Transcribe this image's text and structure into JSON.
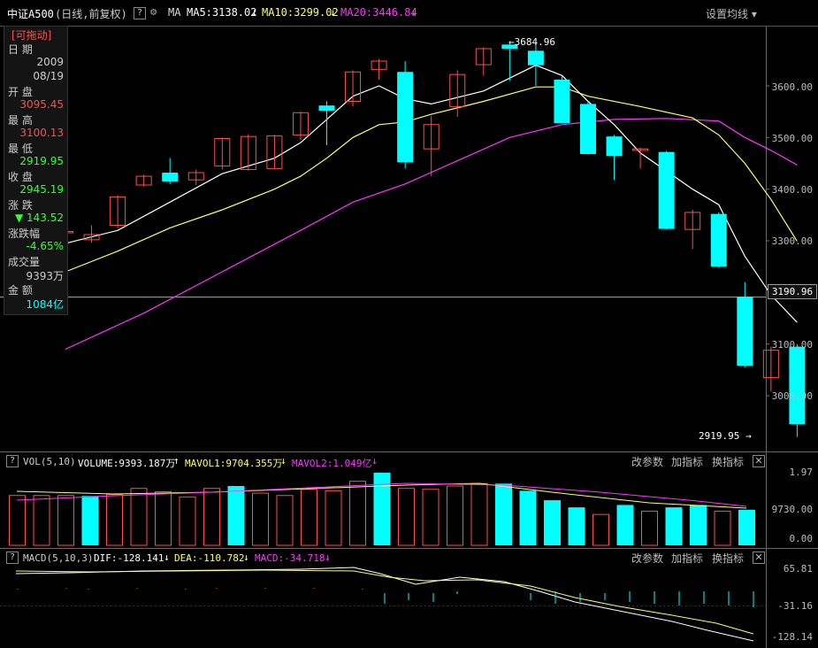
{
  "header": {
    "symbol": "中证A500",
    "period": "(日线,前复权)",
    "help": "?",
    "ma_label": "MA",
    "ma5": "MA5:3138.02",
    "ma10": "MA10:3299.02",
    "ma20": "MA20:3446.84",
    "settings": "设置均线 ▾"
  },
  "info": {
    "draggable": "[可拖动]",
    "date_label": "日  期",
    "year": "2009",
    "date": "08/19",
    "open_label": "开  盘",
    "open": "3095.45",
    "high_label": "最  高",
    "high": "3100.13",
    "low_label": "最  低",
    "low": "2919.95",
    "close_label": "收  盘",
    "close": "2945.19",
    "change_label": "涨  跌",
    "change": "▼ 143.52",
    "pct_label": "涨跌幅",
    "pct": "-4.65%",
    "vol_label": "成交量",
    "vol": "9393万",
    "amt_label": "金  额",
    "amt": "1084亿"
  },
  "price_axis": [
    "3600.00",
    "3500.00",
    "3400.00",
    "3300.00",
    "3100.00",
    "3000.00"
  ],
  "crosshair_value": "3190.96",
  "annotations": {
    "high": "3684.96",
    "low": "2919.95"
  },
  "volume_panel": {
    "box": "?",
    "title": "VOL(5,10)",
    "volume": "VOLUME:9393.187万",
    "mavol1": "MAVOL1:9704.355万",
    "mavol2": "MAVOL2:1.049亿",
    "axis": [
      "1.97",
      "9730.00",
      "0.00"
    ],
    "actions": [
      "改参数",
      "加指标",
      "换指标"
    ]
  },
  "macd_panel": {
    "box": "?",
    "title": "MACD(5,10,3)",
    "dif": "DIF:-128.141",
    "dea": "DEA:-110.782",
    "macd": "MACD:-34.718",
    "axis": [
      "65.81",
      "-31.16",
      "-128.14"
    ],
    "actions": [
      "改参数",
      "加指标",
      "换指标"
    ]
  },
  "colors": {
    "up": "#ff4d4d",
    "down": "#00ffff",
    "ma5": "#ffffff",
    "ma10": "#ffff66",
    "ma20": "#ff33ff"
  },
  "chart_data": {
    "type": "candlestick",
    "y_range": [
      2900,
      3710
    ],
    "candles": [
      {
        "o": 3318,
        "c": 3318,
        "h": 3330,
        "l": 3305
      },
      {
        "o": 3302,
        "c": 3312,
        "h": 3330,
        "l": 3296
      },
      {
        "o": 3330,
        "c": 3385,
        "h": 3388,
        "l": 3325
      },
      {
        "o": 3408,
        "c": 3425,
        "h": 3428,
        "l": 3405
      },
      {
        "o": 3432,
        "c": 3415,
        "h": 3460,
        "l": 3410
      },
      {
        "o": 3418,
        "c": 3432,
        "h": 3438,
        "l": 3408
      },
      {
        "o": 3445,
        "c": 3498,
        "h": 3500,
        "l": 3438
      },
      {
        "o": 3438,
        "c": 3502,
        "h": 3506,
        "l": 3436
      },
      {
        "o": 3440,
        "c": 3503,
        "h": 3505,
        "l": 3440
      },
      {
        "o": 3505,
        "c": 3548,
        "h": 3550,
        "l": 3495
      },
      {
        "o": 3562,
        "c": 3552,
        "h": 3570,
        "l": 3485
      },
      {
        "o": 3570,
        "c": 3627,
        "h": 3630,
        "l": 3560
      },
      {
        "o": 3632,
        "c": 3648,
        "h": 3652,
        "l": 3612
      },
      {
        "o": 3627,
        "c": 3452,
        "h": 3648,
        "l": 3440
      },
      {
        "o": 3478,
        "c": 3525,
        "h": 3542,
        "l": 3425
      },
      {
        "o": 3560,
        "c": 3622,
        "h": 3630,
        "l": 3540
      },
      {
        "o": 3641,
        "c": 3672,
        "h": 3675,
        "l": 3620
      },
      {
        "o": 3680,
        "c": 3672,
        "h": 3682,
        "l": 3610
      },
      {
        "o": 3668,
        "c": 3640,
        "h": 3685,
        "l": 3600
      },
      {
        "o": 3612,
        "c": 3528,
        "h": 3618,
        "l": 3527
      },
      {
        "o": 3565,
        "c": 3468,
        "h": 3570,
        "l": 3467
      },
      {
        "o": 3502,
        "c": 3464,
        "h": 3505,
        "l": 3418
      },
      {
        "o": 3475,
        "c": 3478,
        "h": 3480,
        "l": 3440
      },
      {
        "o": 3472,
        "c": 3323,
        "h": 3474,
        "l": 3322
      },
      {
        "o": 3322,
        "c": 3355,
        "h": 3360,
        "l": 3284
      },
      {
        "o": 3352,
        "c": 3250,
        "h": 3355,
        "l": 3248
      },
      {
        "o": 3192,
        "c": 3058,
        "h": 3220,
        "l": 3055
      },
      {
        "o": 3035,
        "c": 3088,
        "h": 3095,
        "l": 3008
      },
      {
        "o": 3095,
        "c": 2945,
        "h": 3100,
        "l": 2920
      }
    ],
    "ma5": [
      [
        0,
        3295
      ],
      [
        2,
        3320
      ],
      [
        4,
        3375
      ],
      [
        6,
        3430
      ],
      [
        8,
        3460
      ],
      [
        9,
        3490
      ],
      [
        10,
        3535
      ],
      [
        11,
        3580
      ],
      [
        12,
        3600
      ],
      [
        13,
        3575
      ],
      [
        14,
        3565
      ],
      [
        16,
        3590
      ],
      [
        18,
        3640
      ],
      [
        19,
        3620
      ],
      [
        20,
        3570
      ],
      [
        21,
        3525
      ],
      [
        22,
        3470
      ],
      [
        24,
        3400
      ],
      [
        25,
        3370
      ],
      [
        26,
        3270
      ],
      [
        27,
        3195
      ],
      [
        28,
        3142
      ]
    ],
    "ma10": [
      [
        0,
        3240
      ],
      [
        2,
        3280
      ],
      [
        4,
        3325
      ],
      [
        6,
        3360
      ],
      [
        8,
        3400
      ],
      [
        9,
        3425
      ],
      [
        10,
        3460
      ],
      [
        11,
        3500
      ],
      [
        12,
        3525
      ],
      [
        13,
        3530
      ],
      [
        14,
        3545
      ],
      [
        16,
        3570
      ],
      [
        18,
        3598
      ],
      [
        19,
        3598
      ],
      [
        20,
        3580
      ],
      [
        22,
        3560
      ],
      [
        24,
        3538
      ],
      [
        25,
        3505
      ],
      [
        26,
        3450
      ],
      [
        27,
        3380
      ],
      [
        28,
        3299
      ]
    ],
    "ma20": [
      [
        0,
        3090
      ],
      [
        3,
        3160
      ],
      [
        6,
        3240
      ],
      [
        9,
        3320
      ],
      [
        11,
        3375
      ],
      [
        13,
        3410
      ],
      [
        15,
        3455
      ],
      [
        17,
        3500
      ],
      [
        19,
        3525
      ],
      [
        21,
        3535
      ],
      [
        23,
        3537
      ],
      [
        25,
        3532
      ],
      [
        26,
        3500
      ],
      [
        27,
        3475
      ],
      [
        28,
        3447
      ]
    ],
    "volume": [
      {
        "v": 1.05,
        "up": true
      },
      {
        "v": 1.05,
        "up": true
      },
      {
        "v": 1.05,
        "up": true
      },
      {
        "v": 1.04,
        "up": false
      },
      {
        "v": 1.07,
        "up": true
      },
      {
        "v": 1.2,
        "up": true
      },
      {
        "v": 1.13,
        "up": true
      },
      {
        "v": 1.02,
        "up": true
      },
      {
        "v": 1.2,
        "up": true
      },
      {
        "v": 1.25,
        "up": false
      },
      {
        "v": 1.1,
        "up": true
      },
      {
        "v": 1.05,
        "up": true
      },
      {
        "v": 1.18,
        "up": true
      },
      {
        "v": 1.15,
        "up": true
      },
      {
        "v": 1.35,
        "up": true
      },
      {
        "v": 1.53,
        "up": false
      },
      {
        "v": 1.2,
        "up": true
      },
      {
        "v": 1.18,
        "up": true
      },
      {
        "v": 1.25,
        "up": true
      },
      {
        "v": 1.3,
        "up": true
      },
      {
        "v": 1.3,
        "up": false
      },
      {
        "v": 1.15,
        "up": false
      },
      {
        "v": 0.95,
        "up": false
      },
      {
        "v": 0.8,
        "up": false
      },
      {
        "v": 0.65,
        "up": true
      },
      {
        "v": 0.85,
        "up": false
      },
      {
        "v": 0.72,
        "up": true
      },
      {
        "v": 0.8,
        "up": false
      },
      {
        "v": 0.85,
        "up": false
      },
      {
        "v": 0.72,
        "up": true
      },
      {
        "v": 0.75,
        "up": false
      }
    ]
  }
}
